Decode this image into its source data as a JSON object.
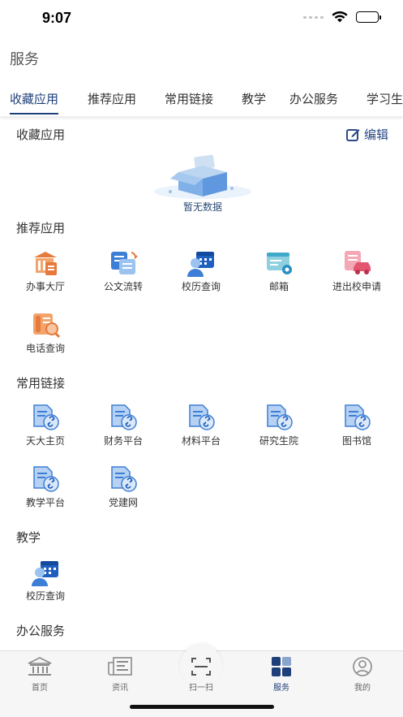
{
  "status": {
    "time": "9:07"
  },
  "header": {
    "title": "服务"
  },
  "tabs": [
    {
      "label": "收藏应用",
      "active": true
    },
    {
      "label": "推荐应用"
    },
    {
      "label": "常用链接"
    },
    {
      "label": "教学"
    },
    {
      "label": "办公服务"
    },
    {
      "label": "学习生"
    }
  ],
  "favorites": {
    "title": "收藏应用",
    "edit_label": "编辑",
    "empty_text": "暂无数据"
  },
  "recommended": {
    "title": "推荐应用",
    "items": [
      {
        "label": "办事大厅",
        "icon": "service-hall-icon"
      },
      {
        "label": "公文流转",
        "icon": "document-flow-icon"
      },
      {
        "label": "校历查询",
        "icon": "calendar-query-icon"
      },
      {
        "label": "邮箱",
        "icon": "mailbox-icon"
      },
      {
        "label": "进出校申请",
        "icon": "campus-access-icon"
      },
      {
        "label": "电话查询",
        "icon": "phone-query-icon"
      }
    ]
  },
  "links": {
    "title": "常用链接",
    "items": [
      {
        "label": "天大主页",
        "icon": "link-doc-icon"
      },
      {
        "label": "财务平台",
        "icon": "link-doc-icon"
      },
      {
        "label": "材料平台",
        "icon": "link-doc-icon"
      },
      {
        "label": "研究生院",
        "icon": "link-doc-icon"
      },
      {
        "label": "图书馆",
        "icon": "link-doc-icon"
      },
      {
        "label": "教学平台",
        "icon": "link-doc-icon"
      },
      {
        "label": "党建网",
        "icon": "link-doc-icon"
      }
    ]
  },
  "teaching": {
    "title": "教学",
    "items": [
      {
        "label": "校历查询",
        "icon": "calendar-query-icon"
      }
    ]
  },
  "office": {
    "title": "办公服务"
  },
  "bottom_nav": [
    {
      "label": "首页",
      "icon": "home-icon"
    },
    {
      "label": "资讯",
      "icon": "news-icon"
    },
    {
      "label": "扫一扫",
      "icon": "scan-icon"
    },
    {
      "label": "服务",
      "icon": "services-grid-icon",
      "active": true
    },
    {
      "label": "我的",
      "icon": "profile-icon"
    }
  ],
  "colors": {
    "accent": "#1f3f7a",
    "icon_blue": "#3d7fd6",
    "icon_orange": "#e57a3c"
  }
}
